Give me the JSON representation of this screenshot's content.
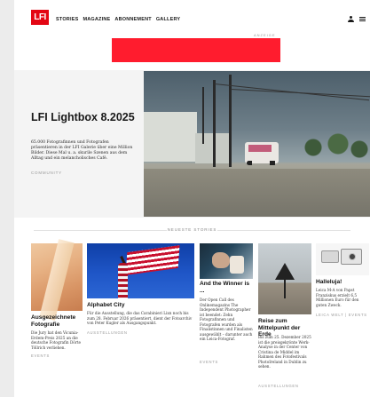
{
  "header": {
    "logo": "LFI",
    "nav": [
      "STORIES",
      "MAGAZINE",
      "ABONNEMENT",
      "GALLERY"
    ]
  },
  "ad": {
    "label": "ANZEIGE",
    "color": "#ff1c2e"
  },
  "hero": {
    "title": "LFI Lightbox 8.2025",
    "text": "65.000 Fotografinnen und Fotografen präsentieren in der LFI Galerie über eine Million Bilder. Diese Mal u. a. skurile Szenen aus dem Alltag und ein melancholisches Café.",
    "tag": "COMMUNITY"
  },
  "section": {
    "label": "NEUESTE STORIES"
  },
  "cards": [
    {
      "title": "Ausgezeichnete Fotografie",
      "text": "Die Jury hat den Vicunia-Erdem-Preis 2025 an die deutsche Fotografin Dörte Töllrich verliehen.",
      "tag": "EVENTS"
    },
    {
      "title": "Alphabet City",
      "text": "Für die Ausstellung, die das Carabinieri Lixn noch bis zum 28. Februar 2026 präsentiert, dient der Fotoarchiv von Peter Kugler als Ausgangspunkt.",
      "tag": "AUSSTELLUNGEN"
    },
    {
      "title": "And the Winner is ...",
      "text": "Der Open Call des Onlinemagazins The Independent Photographer ist beendet: Zehn Fotografinnen und Fotografen wurden als Finalistinnen und Finalisten ausgewählt – darunter auch ein Leica-Fotograf.",
      "tag": "EVENTS"
    },
    {
      "title": "Reise zum Mittelpunkt der Erde",
      "text": "Bis zum 25. Dezember 2025 ist die preisgekrönte Werk-Analyse in der Center von Cristina de Middel im Rahmen des Fotofestivals PhotoIreland in Dublin zu sehen.",
      "tag": "AUSSTELLUNGEN"
    },
    {
      "title": "Halleluja!",
      "text": "Leica M-A von Papst Franziskus erzielt 6,5 Millionen Euro für den guten Zweck.",
      "tag": "LEICA WELT | EVENTS"
    }
  ]
}
